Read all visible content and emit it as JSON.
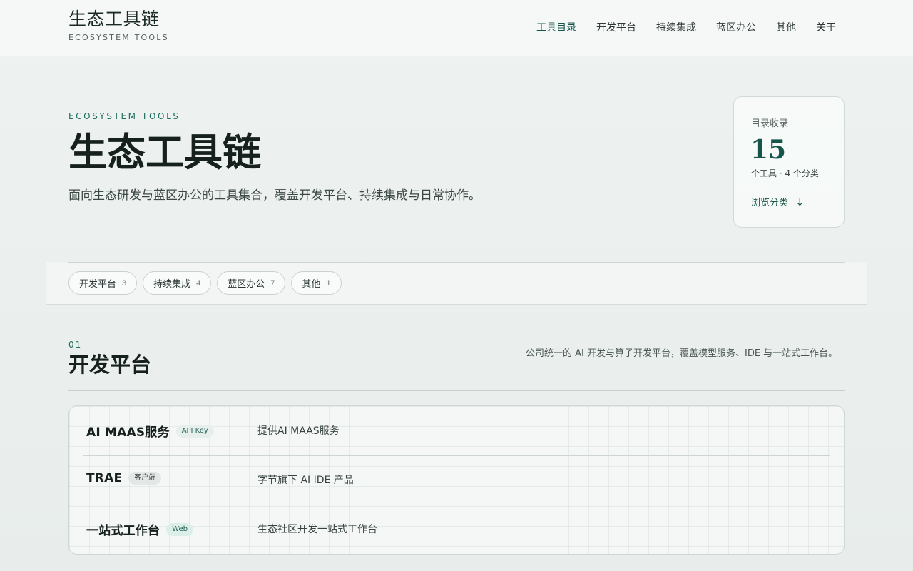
{
  "brand": {
    "title": "生态工具链",
    "subtitle": "ECOSYSTEM TOOLS"
  },
  "nav": [
    {
      "label": "工具目录",
      "active": true
    },
    {
      "label": "开发平台"
    },
    {
      "label": "持续集成"
    },
    {
      "label": "蓝区办公"
    },
    {
      "label": "其他"
    },
    {
      "label": "关于"
    }
  ],
  "hero": {
    "eyebrow": "ECOSYSTEM TOOLS",
    "title": "生态工具链",
    "description": "面向生态研发与蓝区办公的工具集合，覆盖开发平台、持续集成与日常协作。"
  },
  "stats": {
    "label": "目录收录",
    "value": "15",
    "meta": "个工具 · 4 个分类",
    "link": "浏览分类",
    "link_icon": "↓"
  },
  "filters": [
    {
      "label": "开发平台",
      "count": "3"
    },
    {
      "label": "持续集成",
      "count": "4"
    },
    {
      "label": "蓝区办公",
      "count": "7"
    },
    {
      "label": "其他",
      "count": "1"
    }
  ],
  "section": {
    "number": "01",
    "title": "开发平台",
    "description": "公司统一的 AI 开发与算子开发平台，覆盖模型服务、IDE 与一站式工作台。",
    "tools": [
      {
        "name": "AI MAAS服务",
        "tag": "API Key",
        "description": "提供AI MAAS服务"
      },
      {
        "name": "TRAE",
        "tag": "客户端",
        "description": "字节旗下 AI IDE 产品"
      },
      {
        "name": "一站式工作台",
        "tag": "Web",
        "description": "生态社区开发一站式工作台"
      }
    ]
  },
  "colors": {
    "accent": "#16564a",
    "background": "#eef2f0",
    "text": "#1c2a26"
  }
}
